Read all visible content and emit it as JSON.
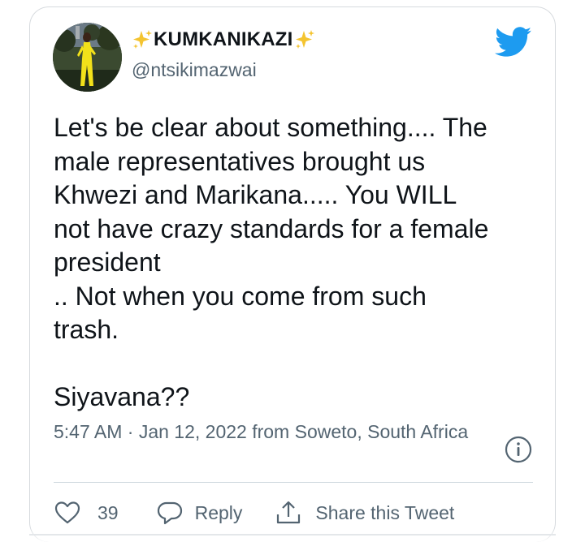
{
  "tweet": {
    "display_name": "KUMKANIKAZI",
    "handle": "@ntsikimazwai",
    "text": "Let's be clear about something.... The\nmale representatives brought us\nKhwezi and Marikana..... You WILL\nnot have crazy standards for a female\npresident\n.. Not when you come from such\ntrash.\n\nSiyavana??",
    "timestamp": "5:47 AM · Jan 12, 2022 from Soweto, South Africa"
  },
  "actions": {
    "like_count": "39",
    "reply_label": "Reply",
    "share_label": "Share this Tweet"
  },
  "icons": {
    "brand": "twitter-bird-icon",
    "name_decoration": "sparkles-icon",
    "info": "info-icon",
    "like": "heart-icon",
    "reply": "reply-bubble-icon",
    "share": "share-icon"
  },
  "colors": {
    "twitter_blue": "#1d9bf0",
    "sparkle": "#f4c430",
    "muted_text": "#536471",
    "divider": "#cfd9de"
  }
}
